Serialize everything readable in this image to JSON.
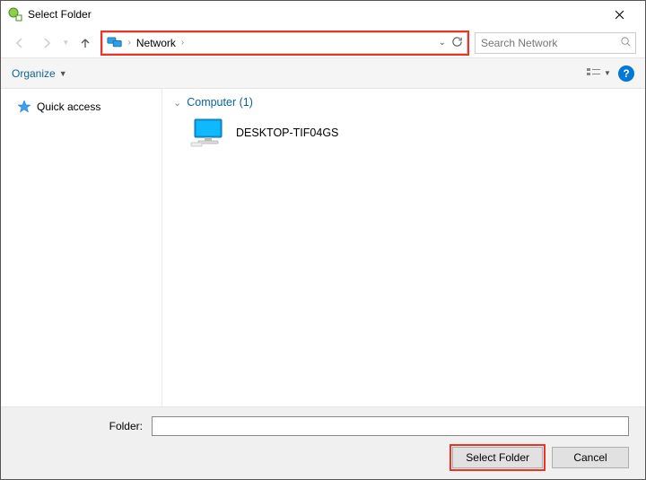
{
  "window": {
    "title": "Select Folder"
  },
  "nav": {
    "breadcrumb": "Network",
    "search_placeholder": "Search Network"
  },
  "cmdbar": {
    "organize_label": "Organize",
    "help_glyph": "?"
  },
  "sidebar": {
    "items": [
      {
        "label": "Quick access"
      }
    ]
  },
  "content": {
    "group_label": "Computer (1)",
    "items": [
      {
        "label": "DESKTOP-TIF04GS"
      }
    ]
  },
  "bottom": {
    "folder_label": "Folder:",
    "folder_value": "",
    "select_label": "Select Folder",
    "cancel_label": "Cancel"
  }
}
